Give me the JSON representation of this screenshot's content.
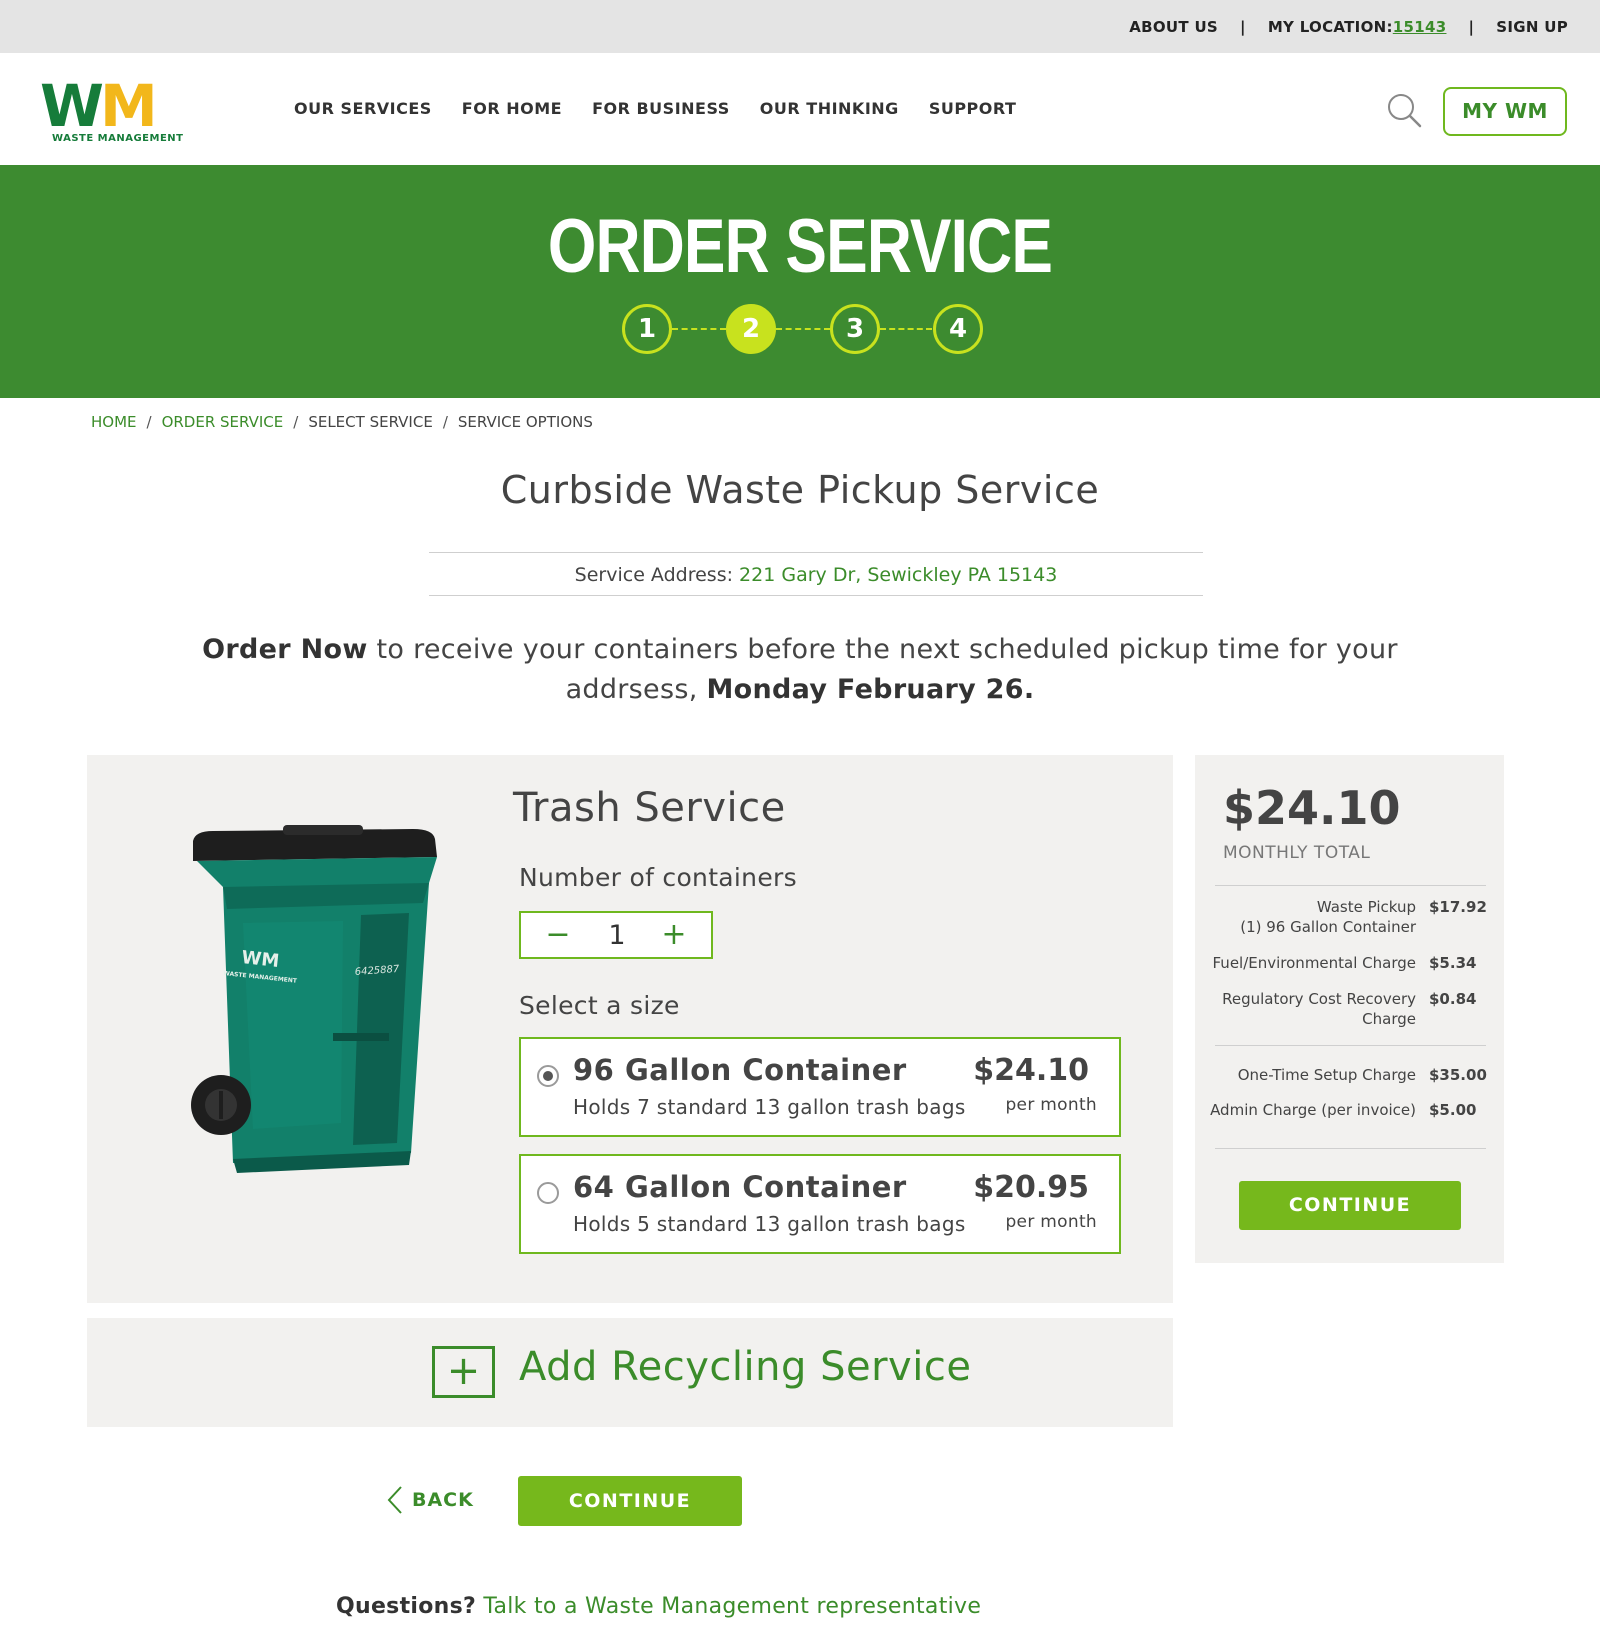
{
  "utility": {
    "about": "ABOUT US",
    "sep": "|",
    "location_label": "MY LOCATION:",
    "location_zip": "15143",
    "signup": "SIGN UP"
  },
  "header": {
    "logo_w": "W",
    "logo_m": "M",
    "logo_sub": "WASTE MANAGEMENT",
    "nav": [
      "OUR SERVICES",
      "FOR HOME",
      "FOR BUSINESS",
      "OUR THINKING",
      "SUPPORT"
    ],
    "mywm": "MY WM"
  },
  "hero": {
    "title": "ORDER SERVICE",
    "steps": [
      "1",
      "2",
      "3",
      "4"
    ],
    "active_step": 2
  },
  "breadcrumb": [
    "HOME",
    "ORDER SERVICE",
    "SELECT SERVICE",
    "SERVICE OPTIONS"
  ],
  "page": {
    "title": "Curbside Waste Pickup Service",
    "address_label": "Service Address:",
    "address": "221 Gary Dr, Sewickley PA 15143",
    "order_bold": "Order Now",
    "order_text": " to receive your containers before the next scheduled pickup time for your addrsess, ",
    "order_date": "Monday February 26."
  },
  "trash": {
    "title": "Trash Service",
    "num_label": "Number of containers",
    "minus": "−",
    "qty": "1",
    "plus": "+",
    "size_label": "Select a size",
    "bin_label": "WM",
    "bin_sub": "WASTE MANAGEMENT",
    "bin_serial": "6425887",
    "options": [
      {
        "name": "96 Gallon Container",
        "desc": "Holds 7 standard 13 gallon trash bags",
        "price": "$24.10",
        "per": "per month",
        "selected": true
      },
      {
        "name": "64 Gallon Container",
        "desc": "Holds 5 standard 13 gallon trash bags",
        "price": "$20.95",
        "per": "per month",
        "selected": false
      }
    ]
  },
  "recycling": {
    "icon": "+",
    "label": "Add Recycling Service"
  },
  "actions": {
    "back": "BACK",
    "continue": "CONTINUE"
  },
  "questions": {
    "bold": "Questions?",
    "link": "Talk to a Waste Management representative"
  },
  "summary": {
    "total": "$24.10",
    "total_label": "MONTHLY TOTAL",
    "rows": [
      {
        "label": "Waste Pickup",
        "label2": "(1) 96 Gallon Container",
        "amount": "$17.92"
      },
      {
        "label": "Fuel/Environmental Charge",
        "label2": "",
        "amount": "$5.34"
      },
      {
        "label": "Regulatory Cost Recovery",
        "label2": "Charge",
        "amount": "$0.84"
      },
      {
        "label": "One-Time Setup Charge",
        "label2": "",
        "amount": "$35.00"
      },
      {
        "label": "Admin Charge (per invoice)",
        "label2": "",
        "amount": "$5.00"
      }
    ],
    "continue": "CONTINUE"
  },
  "colors": {
    "brand_green": "#3d8b30",
    "accent_green": "#76b81c",
    "step_yellow": "#c8e21e",
    "logo_green": "#167c3a",
    "logo_yellow": "#f2b71b"
  }
}
